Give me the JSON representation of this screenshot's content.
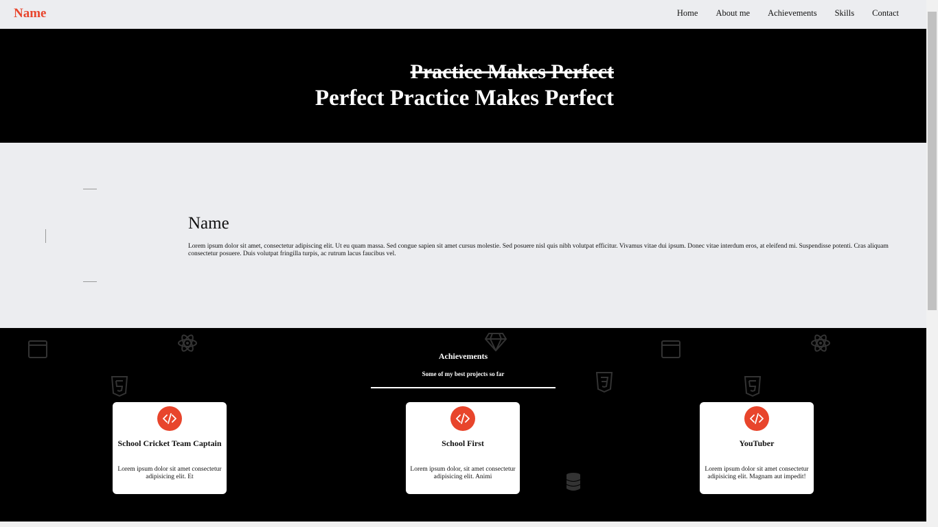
{
  "brand": "Name",
  "nav": [
    "Home",
    "About me",
    "Achievements",
    "Skills",
    "Contact"
  ],
  "hero": {
    "struck": "Practice Makes Perfect",
    "main": "Perfect Practice Makes Perfect"
  },
  "about": {
    "name": "Name",
    "text": "Lorem ipsum dolor sit amet, consectetur adipiscing elit. Ut eu quam massa. Sed congue sapien sit amet cursus molestie. Sed posuere nisl quis nibh volutpat efficitur. Vivamus vitae dui ipsum. Donec vitae interdum eros, at eleifend mi. Suspendisse potenti. Cras aliquam consectetur posuere. Duis volutpat fringilla turpis, ac rutrum lacus faucibus vel."
  },
  "achievements": {
    "title": "Achievements",
    "subtitle": "Some of my best projects so far",
    "cards": [
      {
        "title": "School Cricket Team Captain",
        "desc": "Lorem ipsum dolor sit amet consectetur adipisicing elit. Et"
      },
      {
        "title": "School First",
        "desc": "Lorem ipsum dolor, sit amet consectetur adipisicing elit. Animi"
      },
      {
        "title": "YouTuber",
        "desc": "Lorem ipsum dolor sit amet consectetur adipisicing elit. Magnam aut impedit!"
      }
    ]
  },
  "colors": {
    "accent": "#e8452c",
    "dark": "#000000",
    "light": "#ecedf0"
  },
  "icons": {
    "card": "code-icon",
    "background": [
      "browser-window-icon",
      "atom-icon",
      "diamond-icon",
      "html5-icon",
      "css3-icon",
      "database-icon"
    ]
  }
}
